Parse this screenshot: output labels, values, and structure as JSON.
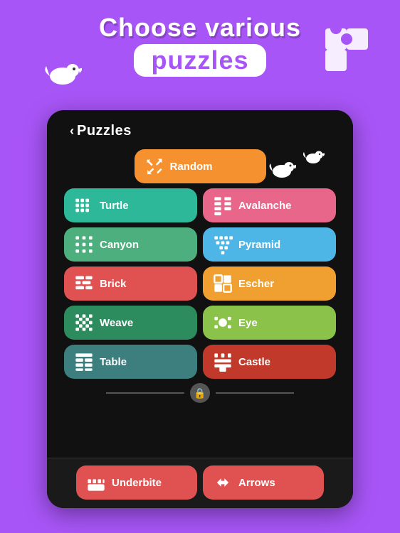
{
  "header": {
    "line1": "Choose various",
    "line2": "puzzles"
  },
  "nav": {
    "back_label": "Puzzles"
  },
  "puzzles": [
    {
      "row": 0,
      "items": [
        {
          "label": "Random",
          "color": "orange",
          "icon": "random"
        }
      ]
    },
    {
      "row": 1,
      "items": [
        {
          "label": "Turtle",
          "color": "teal",
          "icon": "turtle"
        },
        {
          "label": "Avalanche",
          "color": "pink",
          "icon": "avalanche"
        }
      ]
    },
    {
      "row": 2,
      "items": [
        {
          "label": "Canyon",
          "color": "green",
          "icon": "canyon"
        },
        {
          "label": "Pyramid",
          "color": "blue",
          "icon": "pyramid"
        }
      ]
    },
    {
      "row": 3,
      "items": [
        {
          "label": "Brick",
          "color": "red",
          "icon": "brick"
        },
        {
          "label": "Escher",
          "color": "amber",
          "icon": "escher"
        }
      ]
    },
    {
      "row": 4,
      "items": [
        {
          "label": "Weave",
          "color": "dark-green",
          "icon": "weave"
        },
        {
          "label": "Eye",
          "color": "yellow-green",
          "icon": "eye"
        }
      ]
    },
    {
      "row": 5,
      "items": [
        {
          "label": "Table",
          "color": "dark-teal",
          "icon": "table"
        },
        {
          "label": "Castle",
          "color": "bordeaux",
          "icon": "castle"
        }
      ]
    }
  ],
  "locked_items": [
    {
      "label": "Underbite",
      "color": "red",
      "icon": "underbite"
    },
    {
      "label": "Arrows",
      "color": "red",
      "icon": "arrows"
    }
  ],
  "icons": {
    "random": "⇄",
    "turtle": "▦",
    "avalanche": "▤",
    "canyon": "▥",
    "pyramid": "▦",
    "brick": "▩",
    "escher": "▣",
    "weave": "▩",
    "eye": "✦",
    "table": "▦",
    "castle": "▣"
  }
}
